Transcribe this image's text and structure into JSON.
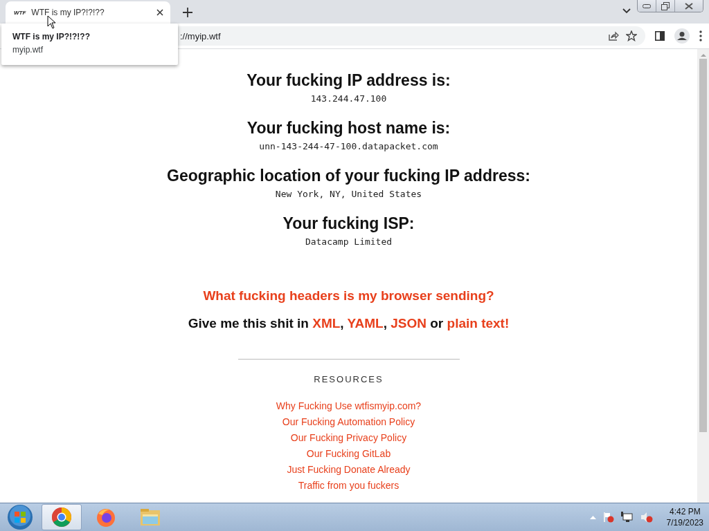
{
  "browser": {
    "tabs": [
      {
        "favicon": "WTF",
        "title": "WTF is my IP?!?!??",
        "selected": true
      }
    ],
    "tooltip": {
      "title": "WTF is my IP?!?!??",
      "url": "myip.wtf"
    },
    "address": "://myip.wtf"
  },
  "page": {
    "sections": [
      {
        "heading": "Your fucking IP address is:",
        "value": "143.244.47.100"
      },
      {
        "heading": "Your fucking host name is:",
        "value": "unn-143-244-47-100.datapacket.com"
      },
      {
        "heading": "Geographic location of your fucking IP address:",
        "value": "New York, NY, United States"
      },
      {
        "heading": "Your fucking ISP:",
        "value": "Datacamp Limited"
      }
    ],
    "headers_link": "What fucking headers is my browser sending?",
    "formats": [
      {
        "text": "Give me this shit in ",
        "link": false
      },
      {
        "text": "XML",
        "link": true
      },
      {
        "text": ", ",
        "link": false
      },
      {
        "text": "YAML",
        "link": true
      },
      {
        "text": ", ",
        "link": false
      },
      {
        "text": "JSON",
        "link": true
      },
      {
        "text": " or ",
        "link": false
      },
      {
        "text": "plain text!",
        "link": true
      }
    ],
    "resources": {
      "heading": "RESOURCES",
      "links": [
        "Why Fucking Use wtfismyip.com?",
        "Our Fucking Automation Policy",
        "Our Fucking Privacy Policy",
        "Our Fucking GitLab",
        "Just Fucking Donate Already",
        "Traffic from you fuckers"
      ]
    }
  },
  "taskbar": {
    "apps": [
      {
        "kind": "chrome",
        "selected": true
      },
      {
        "kind": "firefox",
        "selected": false
      },
      {
        "kind": "folder",
        "selected": false
      }
    ],
    "clock": {
      "time": "4:42 PM",
      "date": "7/19/2023"
    }
  }
}
